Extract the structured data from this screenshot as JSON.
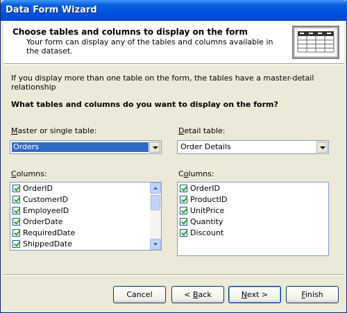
{
  "window": {
    "title": "Data Form Wizard"
  },
  "header": {
    "title": "Choose tables and columns to display on the form",
    "description": "Your form can display any of the tables and columns available in the dataset."
  },
  "info_text": "If you display more than one table on the form, the tables have a master-detail relationship",
  "question": "What tables and columns do you want to display on the form?",
  "master": {
    "label": "Master or single table:",
    "label_accel": "M",
    "label_rest": "aster or single table:",
    "selected": "Orders",
    "columns_label_accel": "C",
    "columns_label_rest": "olumns:",
    "columns": [
      "OrderID",
      "CustomerID",
      "EmployeeID",
      "OrderDate",
      "RequiredDate",
      "ShippedDate"
    ]
  },
  "detail": {
    "label_accel": "D",
    "label_rest": "etail table:",
    "selected": "Order Details",
    "columns_label_pre": "C",
    "columns_label_accel": "o",
    "columns_label_rest": "lumns:",
    "columns": [
      "OrderID",
      "ProductID",
      "UnitPrice",
      "Quantity",
      "Discount"
    ]
  },
  "buttons": {
    "cancel": "Cancel",
    "back_pre": "< ",
    "back_accel": "B",
    "back_rest": "ack",
    "next_accel": "N",
    "next_rest": "ext >",
    "finish_accel": "F",
    "finish_rest": "inish"
  },
  "colors": {
    "selection": "#316ac5",
    "titlebar": "#0053e1",
    "dialog_bg": "#ece9d8"
  }
}
